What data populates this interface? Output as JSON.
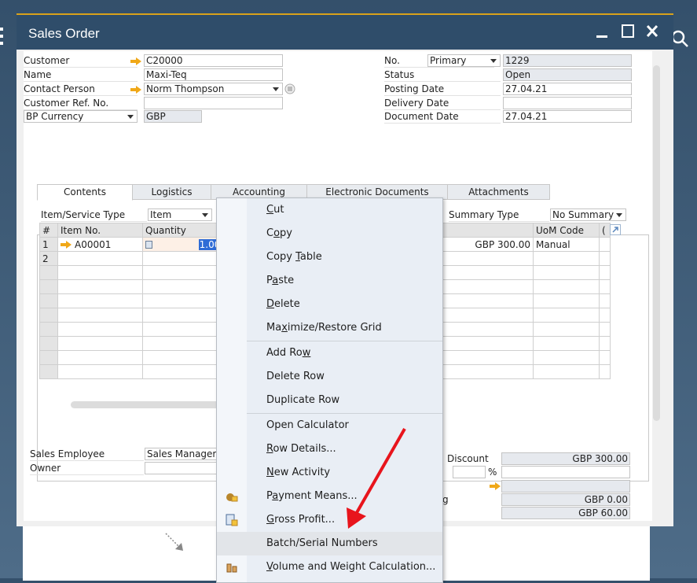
{
  "window": {
    "title": "Sales Order",
    "controls": {
      "minimize": "minimize",
      "maximize": "maximize",
      "close": "close"
    }
  },
  "header_left": {
    "customer": {
      "label": "Customer",
      "value": "C20000"
    },
    "name": {
      "label": "Name",
      "value": "Maxi-Teq"
    },
    "contact_person": {
      "label": "Contact Person",
      "value": "Norm Thompson"
    },
    "customer_ref": {
      "label": "Customer Ref. No.",
      "value": ""
    },
    "currency": {
      "label": "BP Currency",
      "value": "GBP"
    }
  },
  "header_right": {
    "no": {
      "label": "No.",
      "series": "Primary",
      "value": "1229"
    },
    "status": {
      "label": "Status",
      "value": "Open"
    },
    "posting_date": {
      "label": "Posting Date",
      "value": "27.04.21"
    },
    "delivery_date": {
      "label": "Delivery Date",
      "value": ""
    },
    "document_date": {
      "label": "Document Date",
      "value": "27.04.21"
    }
  },
  "tabs": [
    {
      "label": "Contents",
      "active": true
    },
    {
      "label": "Logistics"
    },
    {
      "label": "Accounting"
    },
    {
      "label": "Electronic Documents"
    },
    {
      "label": "Attachments"
    }
  ],
  "contents": {
    "item_service_type": {
      "label": "Item/Service Type",
      "value": "Item"
    },
    "summary_type": {
      "label": "Summary Type",
      "value": "No Summary"
    },
    "grid": {
      "columns": [
        "#",
        "Item No.",
        "Quantity",
        "",
        "UoM Code",
        "("
      ],
      "rows": [
        {
          "num": "1",
          "item_no": "A00001",
          "quantity": "1.000",
          "total": "GBP 300.00",
          "uom": "Manual"
        },
        {
          "num": "2",
          "item_no": "",
          "quantity": "",
          "total": "",
          "uom": ""
        }
      ]
    }
  },
  "footer_left": {
    "sales_employee": {
      "label": "Sales Employee",
      "value": "Sales Manager"
    },
    "owner": {
      "label": "Owner",
      "value": ""
    }
  },
  "footer_right": {
    "discount_label": "Discount",
    "total_before_discount": "GBP 300.00",
    "discount_percent": "",
    "percent_sign": "%",
    "discount_value": "",
    "freight": "",
    "rounding_label_tail": "g",
    "rounding": "GBP 0.00",
    "tax": "GBP 60.00"
  },
  "context_menu": {
    "items": [
      {
        "label_pre": "",
        "mnemonic": "C",
        "label_post": "ut"
      },
      {
        "label_pre": "C",
        "mnemonic": "o",
        "label_post": "py"
      },
      {
        "label_pre": "Copy ",
        "mnemonic": "T",
        "label_post": "able"
      },
      {
        "label_pre": "P",
        "mnemonic": "a",
        "label_post": "ste"
      },
      {
        "label_pre": "",
        "mnemonic": "D",
        "label_post": "elete"
      },
      {
        "label_pre": "Ma",
        "mnemonic": "x",
        "label_post": "imize/Restore Grid"
      },
      {
        "label_pre": "Add Ro",
        "mnemonic": "w",
        "label_post": ""
      },
      {
        "label_pre": "Delete Row",
        "mnemonic": "",
        "label_post": ""
      },
      {
        "label_pre": "Duplicate Row",
        "mnemonic": "",
        "label_post": ""
      },
      {
        "label_pre": "Open Calculator",
        "mnemonic": "",
        "label_post": ""
      },
      {
        "label_pre": "",
        "mnemonic": "R",
        "label_post": "ow Details..."
      },
      {
        "label_pre": "",
        "mnemonic": "N",
        "label_post": "ew Activity"
      },
      {
        "label_pre": "P",
        "mnemonic": "a",
        "label_post": "yment Means...",
        "icon": "money-bag-icon"
      },
      {
        "label_pre": "",
        "mnemonic": "G",
        "label_post": "ross Profit...",
        "icon": "gross-profit-icon"
      },
      {
        "label_pre": "Batch/Serial Numbers",
        "mnemonic": "",
        "label_post": "",
        "highlighted": true
      },
      {
        "label_pre": "",
        "mnemonic": "V",
        "label_post": "olume and Weight Calculation...",
        "icon": "scale-icon"
      }
    ]
  },
  "colors": {
    "titlebar": "#2f4d6a",
    "accent_line": "#d9a21b",
    "link_arrow": "#f0a818",
    "annotation_arrow": "#e8141c",
    "menu_bg": "#e9eef5"
  }
}
